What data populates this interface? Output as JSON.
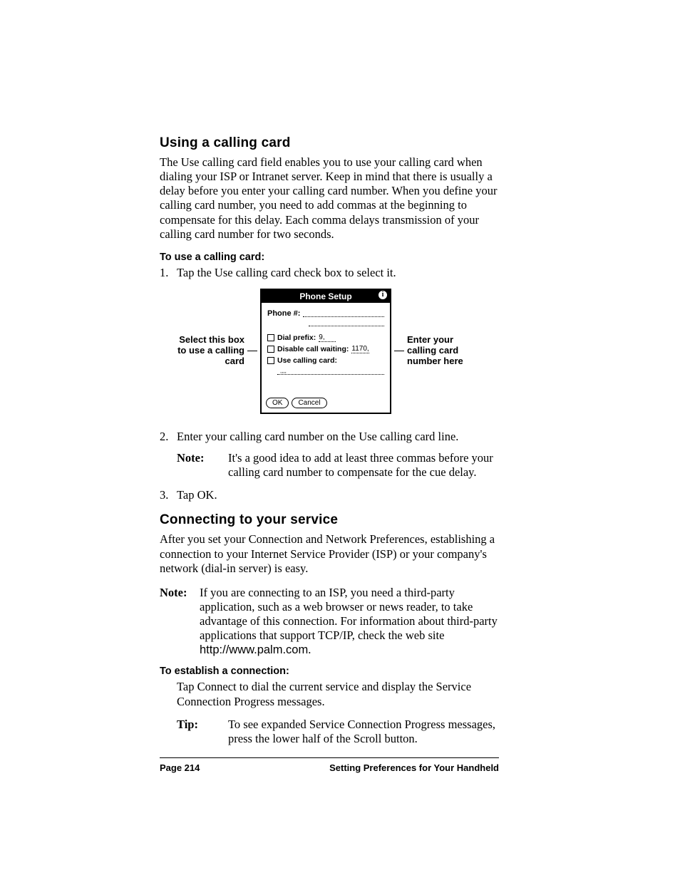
{
  "section1": {
    "heading": "Using a calling card",
    "intro": "The Use calling card field enables you to use your calling card when dialing your ISP or Intranet server. Keep in mind that there is usually a delay before you enter your calling card number. When you define your calling card number, you need to add commas at the beginning to compensate for this delay. Each comma delays transmission of your calling card number for two seconds.",
    "subhead": "To use a calling card:",
    "step1_num": "1.",
    "step1_text": "Tap the Use calling card check box to select it.",
    "step2_num": "2.",
    "step2_text": "Enter your calling card number on the Use calling card line.",
    "note1_label": "Note:",
    "note1_text": "It's a good idea to add at least three commas before your calling card number to compensate for the cue delay.",
    "step3_num": "3.",
    "step3_text": "Tap OK."
  },
  "callouts": {
    "left": "Select this box to use a calling card",
    "right": "Enter your calling card number here"
  },
  "dialog": {
    "title": "Phone Setup",
    "info": "i",
    "phone_label": "Phone #:",
    "dial_prefix_label": "Dial prefix:",
    "dial_prefix_value": "9,",
    "disable_cw_label": "Disable call waiting:",
    "disable_cw_value": "1170,",
    "use_cc_label": "Use calling card:",
    "cc_placeholder": ",,,,",
    "ok_btn": "OK",
    "cancel_btn": "Cancel"
  },
  "section2": {
    "heading": "Connecting to your service",
    "intro": "After you set your Connection and Network Preferences, establishing a connection to your Internet Service Provider (ISP) or your company's network (dial-in server) is easy.",
    "note_label": "Note:",
    "note_text": "If you are connecting to an ISP, you need a third-party application, such as a web browser or news reader, to take advantage of this connection. For information about third-party applications that support TCP/IP, check the web site ",
    "note_url": "http://www.palm.com",
    "note_tail": ".",
    "subhead": "To establish a connection:",
    "body": "Tap Connect to dial the current service and display the Service Connection Progress messages.",
    "tip_label": "Tip:",
    "tip_text": "To see expanded Service Connection Progress messages, press the lower half of the Scroll button."
  },
  "footer": {
    "left": "Page 214",
    "right": "Setting Preferences for Your Handheld"
  }
}
